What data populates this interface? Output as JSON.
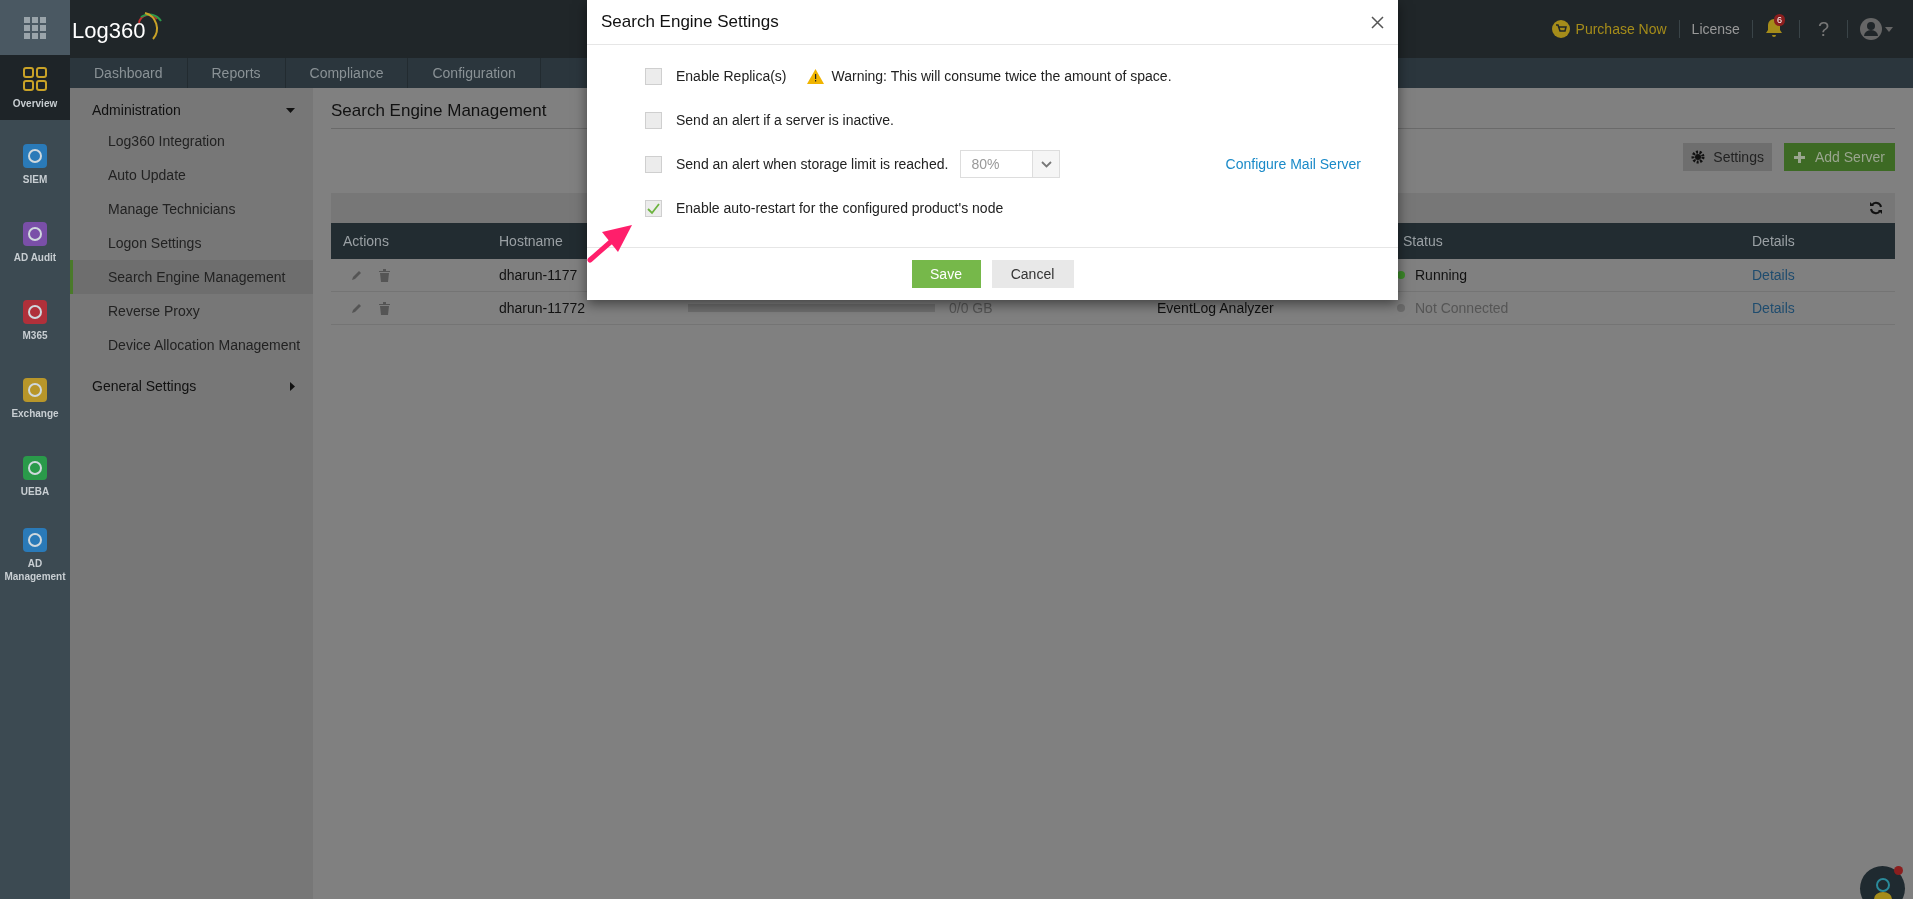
{
  "rail": [
    {
      "label": "Overview",
      "selected": true,
      "color": "#c9a227"
    },
    {
      "label": "SIEM",
      "selected": false,
      "color": "#2a7ab8"
    },
    {
      "label": "AD Audit",
      "selected": false,
      "color": "#7a4fa8"
    },
    {
      "label": "M365",
      "selected": false,
      "color": "#b0303a"
    },
    {
      "label": "Exchange",
      "selected": false,
      "color": "#b8962a"
    },
    {
      "label": "UEBA",
      "selected": false,
      "color": "#2a9a4a"
    },
    {
      "label": "AD Management",
      "selected": false,
      "color": "#2a7ab8"
    }
  ],
  "header": {
    "logo": "Log360",
    "purchase": "Purchase Now",
    "license": "License",
    "notifications": "6",
    "help": "?"
  },
  "tabs": [
    {
      "label": "Dashboard"
    },
    {
      "label": "Reports"
    },
    {
      "label": "Compliance"
    },
    {
      "label": "Configuration"
    }
  ],
  "sidebar": [
    {
      "label": "Administration",
      "expanded": true,
      "children": [
        {
          "label": "Log360 Integration",
          "selected": false
        },
        {
          "label": "Auto Update",
          "selected": false
        },
        {
          "label": "Manage Technicians",
          "selected": false
        },
        {
          "label": "Logon Settings",
          "selected": false
        },
        {
          "label": "Search Engine Management",
          "selected": true
        },
        {
          "label": "Reverse Proxy",
          "selected": false
        },
        {
          "label": "Device Allocation Management",
          "selected": false
        }
      ]
    },
    {
      "label": "General Settings",
      "expanded": false
    }
  ],
  "page": {
    "title": "Search Engine Management",
    "settings": "Settings",
    "add_server": "Add Server"
  },
  "table": {
    "columns": [
      "Actions",
      "Hostname",
      "Status",
      "Details"
    ],
    "rows": [
      {
        "hostname": "dharun-1177",
        "level": null,
        "size": null,
        "product": null,
        "status": "Running",
        "color": "#3c8a2a",
        "details": "Details"
      },
      {
        "hostname": "dharun-11772",
        "level": 0,
        "size": "0/0 GB",
        "product": "EventLog Analyzer",
        "status": "Not Connected",
        "color": "#6a6a6a",
        "details": "Details"
      }
    ]
  },
  "modal": {
    "title": "Search Engine Settings",
    "options": [
      {
        "kind": "warning",
        "label": "Enable Replica(s)",
        "checked": false,
        "warning": "Warning: This will consume twice the amount of space."
      },
      {
        "kind": "plain",
        "label": "Send an alert if a server is inactive.",
        "checked": false
      },
      {
        "kind": "select",
        "label": "Send an alert when storage limit is reached.",
        "checked": false,
        "value": "80%",
        "link": "Configure Mail Server"
      },
      {
        "kind": "plain",
        "label": "Enable auto-restart for the configured product's node",
        "checked": true
      }
    ],
    "save": "Save",
    "cancel": "Cancel"
  }
}
